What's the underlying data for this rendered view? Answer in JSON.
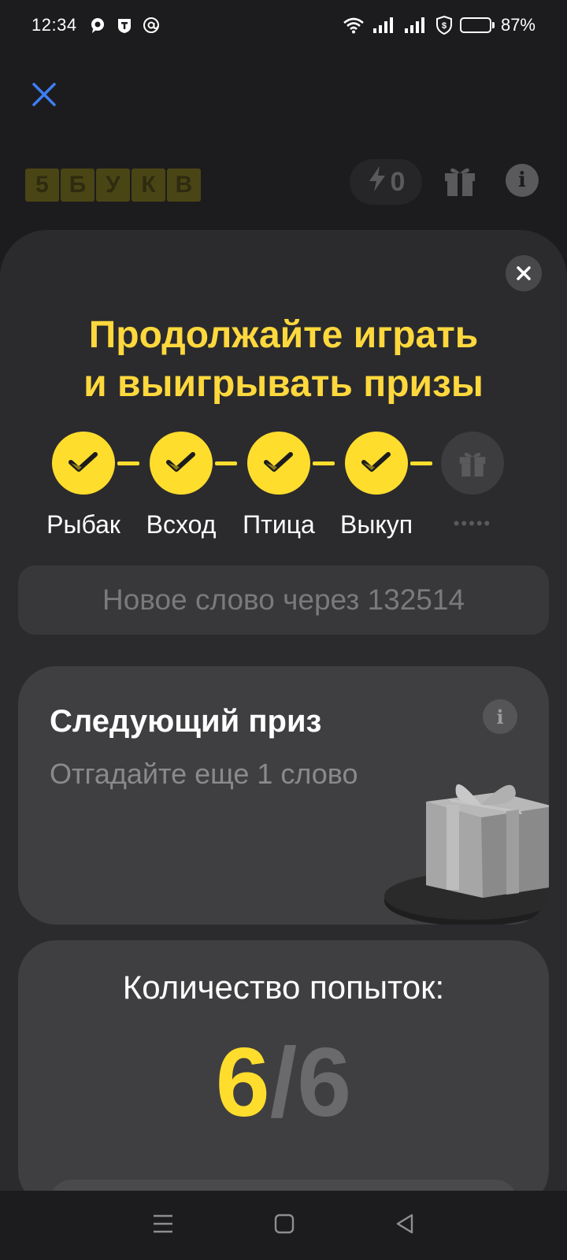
{
  "status_bar": {
    "time": "12:34",
    "battery_percent": "87%",
    "battery_level": 0.87,
    "left_icons": [
      "chat-bubble-icon",
      "tinkoff-t-icon",
      "at-sign-icon"
    ],
    "right_icons": [
      "wifi-icon",
      "signal-icon",
      "signal-icon",
      "vpn-shield-icon",
      "battery-icon"
    ]
  },
  "header": {
    "logo_letters": [
      "5",
      "Б",
      "У",
      "К",
      "В"
    ],
    "energy_count": "0",
    "icons": [
      "close-icon",
      "lightning-icon",
      "gift-icon",
      "info-icon"
    ]
  },
  "sheet": {
    "title_line1": "Продолжайте играть",
    "title_line2": "и выигрывать призы",
    "steps": [
      {
        "label": "Рыбак",
        "done": true
      },
      {
        "label": "Всход",
        "done": true
      },
      {
        "label": "Птица",
        "done": true
      },
      {
        "label": "Выкуп",
        "done": true
      },
      {
        "label": "•••••",
        "done": false
      }
    ],
    "timer_text": "Новое слово через 132514",
    "next_prize": {
      "title": "Следующий приз",
      "subtitle": "Отгадайте еще 1 слово"
    },
    "attempts": {
      "label": "Количество попыток:",
      "used": "6",
      "separator": "/",
      "total": "6"
    }
  },
  "colors": {
    "accent": "#ffdd2d",
    "background": "#1c1c1e",
    "sheet": "#2b2b2d",
    "card": "#3f3f41",
    "close_blue": "#3d7ff5"
  }
}
